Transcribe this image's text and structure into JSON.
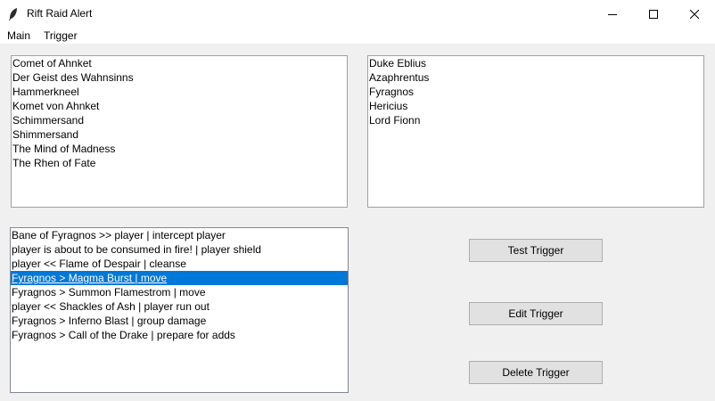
{
  "window": {
    "title": "Rift Raid Alert"
  },
  "menu": {
    "items": [
      "Main",
      "Trigger"
    ]
  },
  "raids": [
    "Comet of Ahnket",
    "Der Geist des Wahnsinns",
    "Hammerkneel",
    "Komet von Ahnket",
    "Schimmersand",
    "Shimmersand",
    "The Mind of Madness",
    "The Rhen of Fate"
  ],
  "bosses": [
    "Duke Eblius",
    "Azaphrentus",
    "Fyragnos",
    "Hericius",
    "Lord Fionn"
  ],
  "triggers": {
    "items": [
      "Bane of Fyragnos >> player | intercept player",
      "player is about to be consumed in fire! | player shield",
      "player << Flame of Despair | cleanse",
      "Fyragnos > Magma Burst | move",
      "Fyragnos > Summon Flamestrom | move",
      "player << Shackles of Ash | player run out",
      "Fyragnos > Inferno Blast | group damage",
      "Fyragnos > Call of the Drake | prepare for adds"
    ],
    "selected_index": 3
  },
  "buttons": {
    "test": "Test Trigger",
    "edit": "Edit Trigger",
    "delete": "Delete Trigger"
  },
  "colors": {
    "selection": "#0078d7",
    "window_bg": "#f0f0f0"
  }
}
